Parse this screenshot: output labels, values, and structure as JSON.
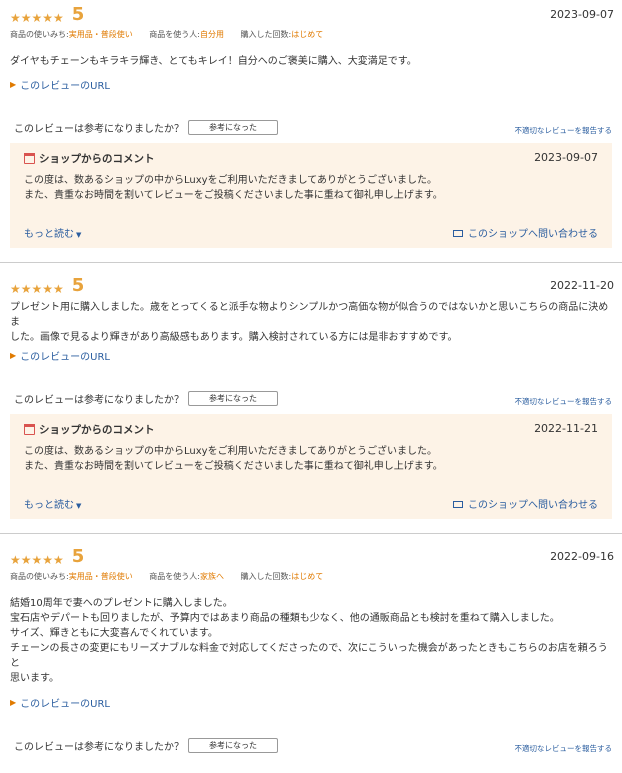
{
  "reviews": [
    {
      "stars": "★★★★★",
      "score": "5",
      "date": "2023-09-07",
      "meta": [
        {
          "k": "商品の使いみち:",
          "v": "実用品・普段使い"
        },
        {
          "k": "商品を使う人:",
          "v": "自分用"
        },
        {
          "k": "購入した回数:",
          "v": "はじめて"
        }
      ],
      "body": "ダイヤもチェーンもキラキラ輝き、とてもキレイ！自分へのご褒美に購入、大変満足です。",
      "url_label": "このレビューのURL",
      "helpful_q": "このレビューは参考になりましたか？",
      "helpful_btn": "参考になった",
      "report": "不適切なレビューを報告する",
      "shop": {
        "title": "ショップからのコメント",
        "date": "2023-09-07",
        "line1": "この度は、数あるショップの中からLuxyをご利用いただきましてありがとうございました。",
        "line2": "また、貴重なお時間を割いてレビューをご投稿くださいました事に重ねて御礼申し上げます。",
        "more": "もっと読む",
        "contact": "このショップへ問い合わせる"
      }
    },
    {
      "stars": "★★★★★",
      "score": "5",
      "date": "2022-11-20",
      "body1": "プレゼント用に購入しました。歳をとってくると派手な物よりシンプルかつ高価な物が似合うのではないかと思いこちらの商品に決めま",
      "body2": "した。画像で見るより輝きがあり高級感もあります。購入検討されている方には是非おすすめです。",
      "url_label": "このレビューのURL",
      "helpful_q": "このレビューは参考になりましたか？",
      "helpful_btn": "参考になった",
      "report": "不適切なレビューを報告する",
      "shop": {
        "title": "ショップからのコメント",
        "date": "2022-11-21",
        "line1": "この度は、数あるショップの中からLuxyをご利用いただきましてありがとうございました。",
        "line2": "また、貴重なお時間を割いてレビューをご投稿くださいました事に重ねて御礼申し上げます。",
        "more": "もっと読む",
        "contact": "このショップへ問い合わせる"
      }
    },
    {
      "stars": "★★★★★",
      "score": "5",
      "date": "2022-09-16",
      "meta": [
        {
          "k": "商品の使いみち:",
          "v": "実用品・普段使い"
        },
        {
          "k": "商品を使う人:",
          "v": "家族へ"
        },
        {
          "k": "購入した回数:",
          "v": "はじめて"
        }
      ],
      "body1": "結婚10周年で妻へのプレゼントに購入しました。",
      "body2": "宝石店やデパートも回りましたが、予算内ではあまり商品の種類も少なく、他の通販商品とも検討を重ねて購入しました。",
      "body3": "サイズ、輝きともに大変喜んでくれています。",
      "body4": "チェーンの長さの変更にもリーズナブルな料金で対応してくださったので、次にこういった機会があったときもこちらのお店を頼ろうと",
      "body5": "思います。",
      "url_label": "このレビューのURL",
      "helpful_q": "このレビューは参考になりましたか？",
      "helpful_btn": "参考になった",
      "report": "不適切なレビューを報告する"
    }
  ],
  "colors": {
    "accent": "#e8a33c",
    "link": "#2a5d9f",
    "shop_bg": "#fdf3e7"
  }
}
